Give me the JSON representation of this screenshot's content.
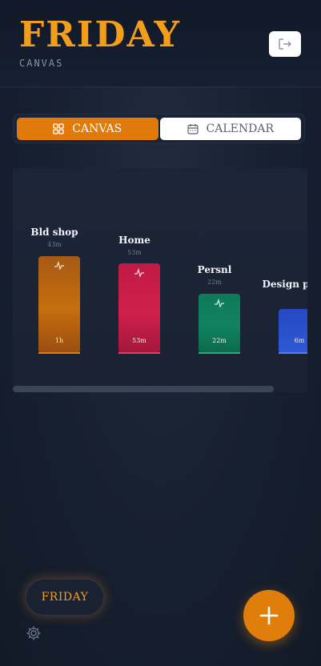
{
  "header": {
    "title": "FRIDAY",
    "subtitle": "CANVAS",
    "logout_icon": "logout-icon"
  },
  "tabs": [
    {
      "label": "CANVAS",
      "icon": "grid-icon",
      "active": true
    },
    {
      "label": "CALENDAR",
      "icon": "calendar-icon",
      "active": false
    }
  ],
  "columns": [
    {
      "title": "Bld shop",
      "subtitle": "43m",
      "value": "1h",
      "color": "#c26a10",
      "icon": "activity-icon"
    },
    {
      "title": "Home",
      "subtitle": "53m",
      "value": "53m",
      "color": "#c81d47",
      "icon": "activity-icon"
    },
    {
      "title": "Persnl",
      "subtitle": "22m",
      "value": "22m",
      "color": "#0f7a55",
      "icon": "activity-icon"
    },
    {
      "title": "Design plans.",
      "subtitle": "",
      "value": "6m",
      "color": "#2a53c9",
      "icon": "activity-icon"
    }
  ],
  "footer": {
    "assistant_label": "FRIDAY",
    "settings_icon": "gear-icon",
    "add_icon": "plus-icon"
  },
  "colors": {
    "accent": "#f29d1b",
    "active_tab": "#e07a0a"
  }
}
